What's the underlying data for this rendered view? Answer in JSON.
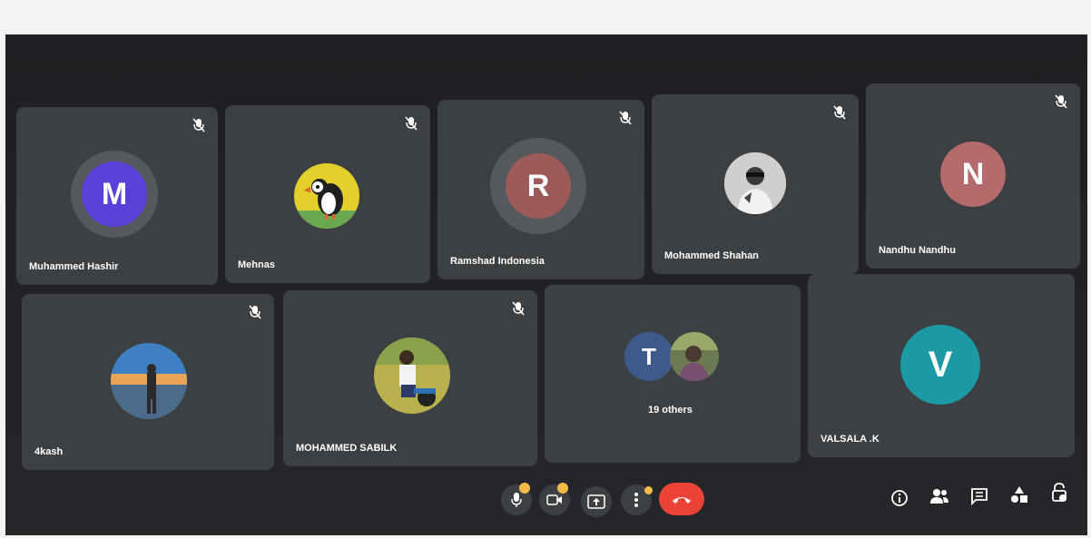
{
  "participants": [
    {
      "name": "Muhammed Hashir",
      "initial": "M",
      "avatar_color": "#5a3fd9",
      "muted": true
    },
    {
      "name": "Mehnas",
      "initial": "",
      "avatar_kind": "puffin-photo",
      "muted": true
    },
    {
      "name": "Ramshad Indonesia",
      "initial": "R",
      "avatar_color": "#9c5a58",
      "muted": true
    },
    {
      "name": "Mohammed Shahan",
      "initial": "",
      "avatar_kind": "person-photo",
      "muted": true
    },
    {
      "name": "Nandhu Nandhu",
      "initial": "N",
      "avatar_color": "#b56b6b",
      "muted": true
    },
    {
      "name": "4kash",
      "initial": "",
      "avatar_kind": "sunset-photo",
      "muted": true
    },
    {
      "name": "MOHAMMED SABILK",
      "initial": "",
      "avatar_kind": "bike-photo",
      "muted": true
    },
    {
      "name": "VALSALA .K",
      "initial": "V",
      "avatar_color": "#1b9aa6",
      "muted": false
    }
  ],
  "others_tile": {
    "initial": "T",
    "avatar_color": "#3d5a8a",
    "label": "19 others"
  },
  "controls": {
    "mic": "microphone-icon",
    "camera": "camera-icon",
    "present": "present-screen-icon",
    "more": "more-options-icon",
    "leave": "leave-call-icon",
    "warning_color": "#f5b945",
    "leave_color": "#ea4335"
  },
  "side_controls": [
    "info-icon",
    "people-icon",
    "chat-icon",
    "activities-icon",
    "host-controls-icon"
  ]
}
